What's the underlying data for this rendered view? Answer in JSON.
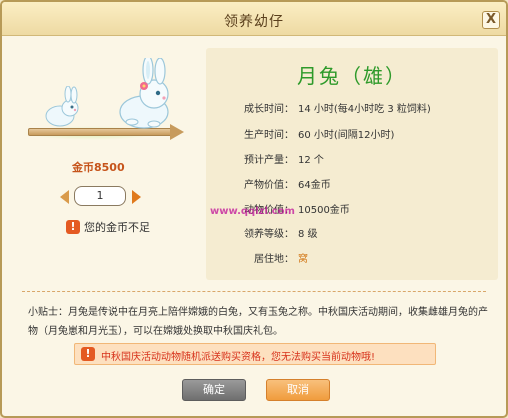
{
  "window": {
    "title": "领养幼仔",
    "close_label": "X"
  },
  "pet": {
    "name": "月兔（雄）",
    "price_label": "金币8500",
    "quantity": "1",
    "insufficient_warning": "您的金币不足"
  },
  "info": [
    {
      "label": "成长时间：",
      "value": "14 小时(每4小时吃 3 粒饲料)"
    },
    {
      "label": "生产时间：",
      "value": "60 小时(间隔12小时)"
    },
    {
      "label": "预计产量：",
      "value": "12 个"
    },
    {
      "label": "产物价值：",
      "value": "64金币"
    },
    {
      "label": "动物价值：",
      "value": "10500金币"
    },
    {
      "label": "领养等级：",
      "value": "8 级"
    },
    {
      "label": "居住地：",
      "value": "窝"
    }
  ],
  "watermark": "www.qqlzl.com",
  "tip": "小贴士：月兔是传说中在月亮上陪伴嫦娥的白兔，又有玉兔之称。中秋国庆活动期间，收集雌雄月兔的产物（月兔崽和月光玉），可以在嫦娥处换取中秋国庆礼包。",
  "notice": "中秋国庆活动动物随机派送购买资格，您无法购买当前动物哦!",
  "buttons": {
    "ok": "确定",
    "cancel": "取消"
  },
  "colors": {
    "accent_green": "#2e9a2a",
    "accent_orange": "#e07a1d",
    "warning_red": "#d7321b"
  }
}
